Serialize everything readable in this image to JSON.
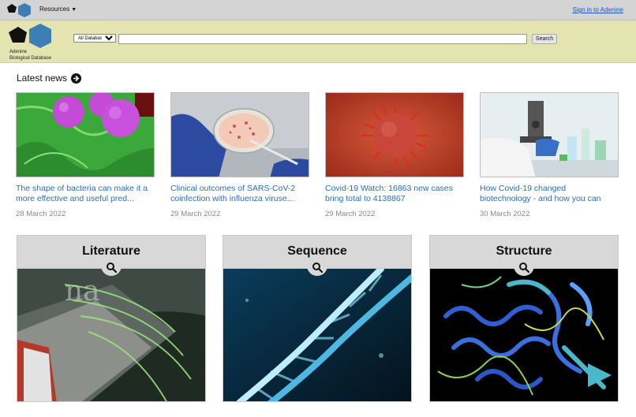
{
  "topnav": {
    "menu_label": "Resources",
    "signin_label": "Sign in to Adenine"
  },
  "banner": {
    "logo_line1": "Adenine",
    "logo_line2": "Biological Database",
    "database_select": "All Databases",
    "search_placeholder": "",
    "search_button": "Search"
  },
  "news": {
    "heading": "Latest news",
    "items": [
      {
        "title": "The shape of bacteria can make it a more effective and useful pred...",
        "date": "28 March 2022"
      },
      {
        "title": "Clinical outcomes of SARS-CoV-2 coinfection with influenza viruse...",
        "date": "29 March 2022"
      },
      {
        "title": "Covid-19 Watch: 16863 new cases bring total to 4138867",
        "date": "29 March 2022"
      },
      {
        "title": "How Covid-19 changed biotechnology - and how you can",
        "date": "30 March 2022"
      }
    ]
  },
  "categories": [
    {
      "label": "Literature"
    },
    {
      "label": "Sequence"
    },
    {
      "label": "Structure"
    }
  ],
  "colors": {
    "banner": "#e4e4b0",
    "link": "#2a6fbd",
    "logo_blue": "#3b7fb5"
  }
}
